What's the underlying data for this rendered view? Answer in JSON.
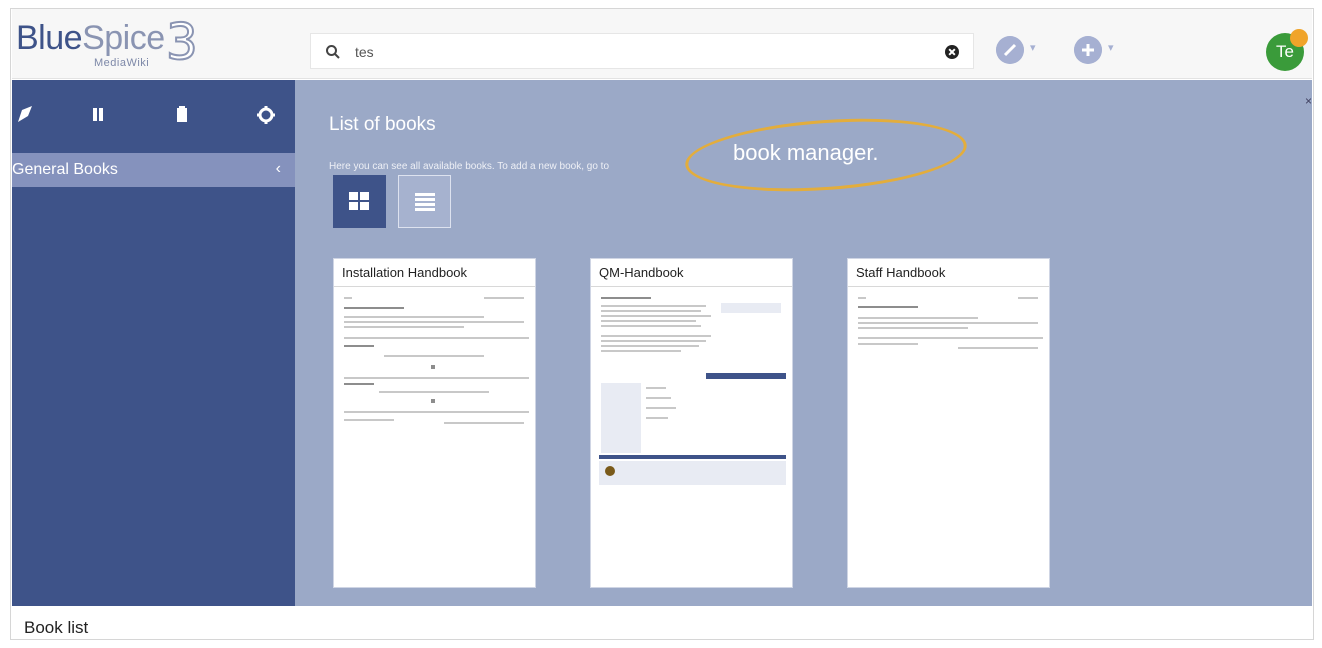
{
  "header": {
    "logo_main": "BlueSpice",
    "logo_sub": "MediaWiki",
    "logo_number": "3",
    "search_value": "tes",
    "avatar_initials": "Te",
    "notification_count": ""
  },
  "sidebar": {
    "tabs": [
      {
        "icon": "navigation-arrow-icon"
      },
      {
        "icon": "book-icon"
      },
      {
        "icon": "clipboard-icon"
      },
      {
        "icon": "gear-icon"
      }
    ],
    "section_title": "General Books",
    "collapse_glyph": "‹"
  },
  "main": {
    "title": "List of books",
    "description": "Here you can see all available books. To add a new book, go to",
    "link_text": "book manager."
  },
  "books": [
    {
      "title": "Installation Handbook"
    },
    {
      "title": "QM-Handbook"
    },
    {
      "title": "Staff Handbook"
    }
  ],
  "caption": "Book list",
  "colors": {
    "brand_blue": "#3e5389",
    "content_bg": "#9ba9c7",
    "annotation_orange": "#e3ad3c",
    "avatar_green": "#3a9b3a"
  }
}
